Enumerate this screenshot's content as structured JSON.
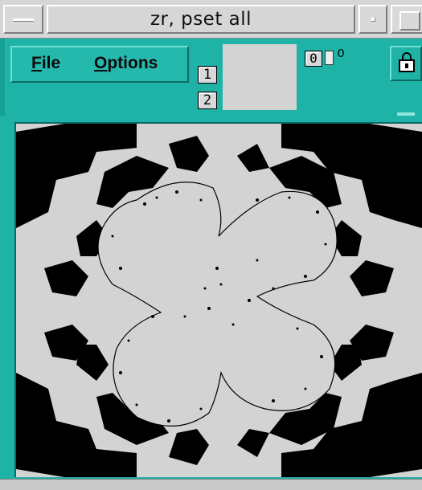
{
  "window": {
    "title": "zr, pset all"
  },
  "menu": {
    "file": {
      "mnemonic": "F",
      "rest": "ile"
    },
    "options": {
      "mnemonic": "O",
      "rest": "ptions"
    }
  },
  "toolbar": {
    "chip_1": "1",
    "chip_2": "2",
    "chip_0": "0",
    "toggle_value": "0",
    "tool_icon": "lock-icon"
  },
  "canvas": {
    "content": "fractal-image",
    "colors": {
      "foreground": "#000000",
      "background": "#d3d3d3"
    }
  },
  "colors": {
    "accent": "#1fb3a8",
    "titlebar": "#d6d6d6"
  }
}
